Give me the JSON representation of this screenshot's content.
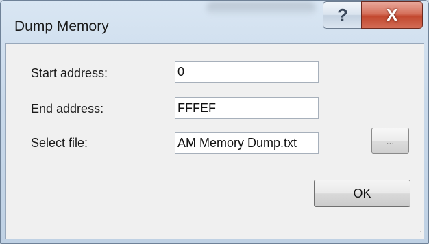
{
  "window": {
    "title": "Dump Memory",
    "help_glyph": "?",
    "close_glyph": "X",
    "icons": {
      "help": "help-icon",
      "close": "close-icon"
    }
  },
  "form": {
    "start_label": "Start address:",
    "start_value": "0",
    "end_label": "End address:",
    "end_value": "FFFEF",
    "file_label": "Select file:",
    "file_value": "AM Memory Dump.txt",
    "browse_label": "...",
    "ok_label": "OK"
  },
  "colors": {
    "client_bg": "#f0f0f0",
    "close_button": "#c2482f",
    "titlebar": "#d9e6f3"
  }
}
